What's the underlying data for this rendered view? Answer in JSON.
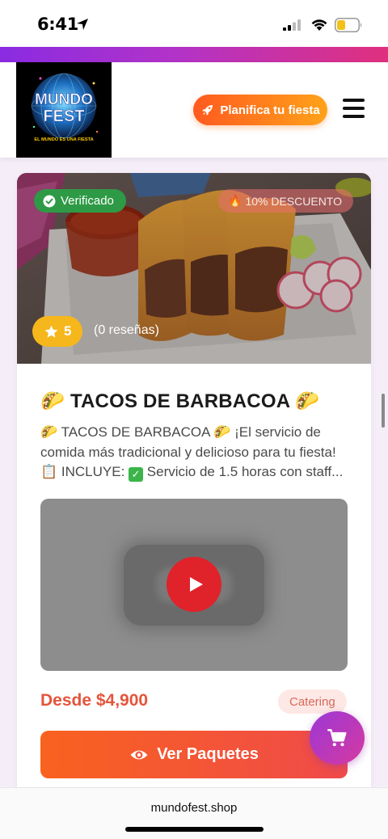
{
  "status_bar": {
    "time": "6:41"
  },
  "header": {
    "logo_text_top": "MUNDO",
    "logo_text_bottom": "FEST",
    "logo_tagline": "EL MUNDO ES UNA FIESTA",
    "plan_button_label": "Planifica tu fiesta"
  },
  "listing": {
    "verified_badge": "Verificado",
    "discount_badge": "10% DESCUENTO",
    "rating_value": "5",
    "reviews_label": "(0 reseñas)",
    "title": "🌮 TACOS DE BARBACOA 🌮",
    "description_line1": "🌮 TACOS DE BARBACOA 🌮 ¡El servicio de",
    "description_line2": "comida más tradicional y delicioso para tu fiesta!",
    "description_line3_prefix": "📋 INCLUYE:",
    "description_line3_suffix": "Servicio de 1.5 horas con staff...",
    "price": "Desde $4,900",
    "category_tag": "Catering",
    "cta_label": "Ver Paquetes"
  },
  "browser": {
    "url": "mundofest.shop"
  },
  "colors": {
    "accent_orange": "#f8621f",
    "verified_green": "#2e9a46",
    "rating_yellow": "#f6b71c",
    "price_red": "#e4553c",
    "brand_purple": "#9b37d6"
  },
  "icons": {
    "location": "location-arrow-icon",
    "rocket": "rocket-icon",
    "menu": "hamburger-menu-icon",
    "verified": "check-circle-icon",
    "discount": "fire-icon",
    "star": "star-icon",
    "play": "youtube-play-icon",
    "eye": "eye-icon",
    "cart": "shopping-cart-icon"
  }
}
